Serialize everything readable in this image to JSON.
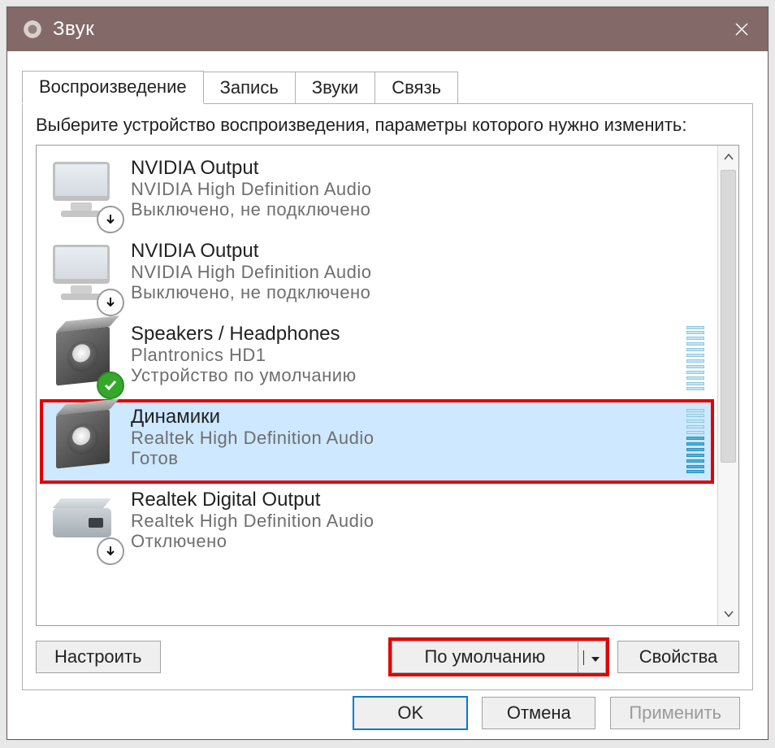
{
  "window": {
    "title": "Звук"
  },
  "tabs": [
    {
      "label": "Воспроизведение",
      "active": true
    },
    {
      "label": "Запись",
      "active": false
    },
    {
      "label": "Звуки",
      "active": false
    },
    {
      "label": "Связь",
      "active": false
    }
  ],
  "instruction": "Выберите устройство воспроизведения, параметры которого нужно изменить:",
  "devices": [
    {
      "name": "NVIDIA Output",
      "desc": "NVIDIA High Definition Audio",
      "status": "Выключено, не подключено",
      "icon": "monitor",
      "overlay": "down",
      "selected": false,
      "meter": false
    },
    {
      "name": "NVIDIA Output",
      "desc": "NVIDIA High Definition Audio",
      "status": "Выключено, не подключено",
      "icon": "monitor",
      "overlay": "down",
      "selected": false,
      "meter": false
    },
    {
      "name": "Speakers / Headphones",
      "desc": "Plantronics HD1",
      "status": "Устройство по умолчанию",
      "icon": "speaker",
      "overlay": "check",
      "selected": false,
      "meter": true,
      "meter_active": false
    },
    {
      "name": "Динамики",
      "desc": "Realtek High Definition Audio",
      "status": "Готов",
      "icon": "speaker",
      "overlay": null,
      "selected": true,
      "meter": true,
      "meter_active": true
    },
    {
      "name": "Realtek Digital Output",
      "desc": "Realtek High Definition Audio",
      "status": "Отключено",
      "icon": "box",
      "overlay": "down",
      "selected": false,
      "meter": false
    }
  ],
  "buttons": {
    "configure": "Настроить",
    "set_default": "По умолчанию",
    "properties": "Свойства",
    "ok": "OK",
    "cancel": "Отмена",
    "apply": "Применить"
  }
}
